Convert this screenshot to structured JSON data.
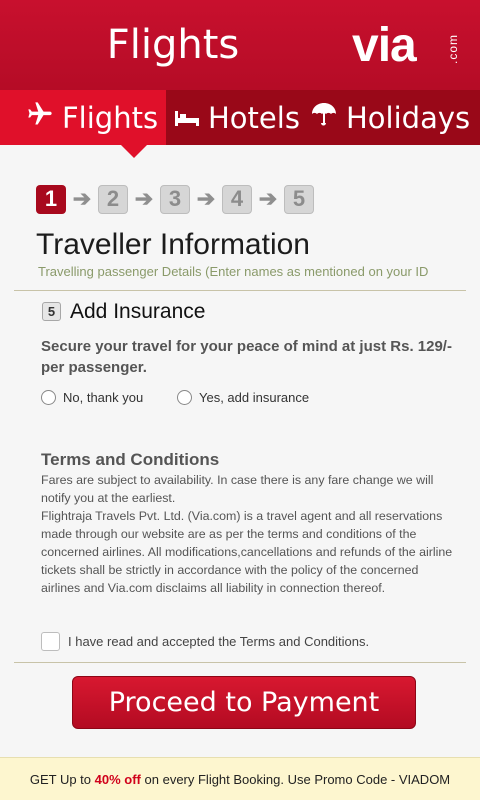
{
  "header": {
    "title": "Flights",
    "logo_text": "via",
    "logo_sub": ".com"
  },
  "tabs": [
    {
      "label": "Flights",
      "icon": "airplane-icon",
      "active": true
    },
    {
      "label": "Hotels",
      "icon": "bed-icon",
      "active": false
    },
    {
      "label": "Holidays",
      "icon": "umbrella-icon",
      "active": false
    }
  ],
  "steps": [
    "1",
    "2",
    "3",
    "4",
    "5"
  ],
  "active_step": "1",
  "section": {
    "title": "Traveller Information",
    "subtitle": "Travelling passenger Details (Enter names as mentioned on your ID"
  },
  "insurance": {
    "step_badge": "5",
    "title": "Add Insurance",
    "description": "Secure your travel for your peace of mind at just Rs. 129/- per passenger.",
    "options": [
      "No, thank you",
      "Yes, add insurance"
    ]
  },
  "terms": {
    "title": "Terms and Conditions",
    "body": "Fares are subject to availability. In case there is any fare change we will notify you at the earliest.\nFlightraja Travels Pvt. Ltd. (Via.com) is a travel agent and all reservations made through our website are as per the terms and conditions of the concerned airlines. All modifications,cancellations and refunds of the airline tickets shall be strictly in accordance with the policy of the concerned airlines and Via.com disclaims all liability in connection thereof.",
    "checkbox_label": "I have read and accepted the Terms and Conditions."
  },
  "proceed_label": "Proceed to Payment",
  "promo": {
    "prefix": "GET Up to",
    "highlight": "40% off",
    "suffix": "on every Flight Booking. Use Promo Code - VIADOM"
  },
  "colors": {
    "brand_red": "#c8102e",
    "tab_dark": "#990818",
    "promo_bg": "#fdf6cf"
  }
}
